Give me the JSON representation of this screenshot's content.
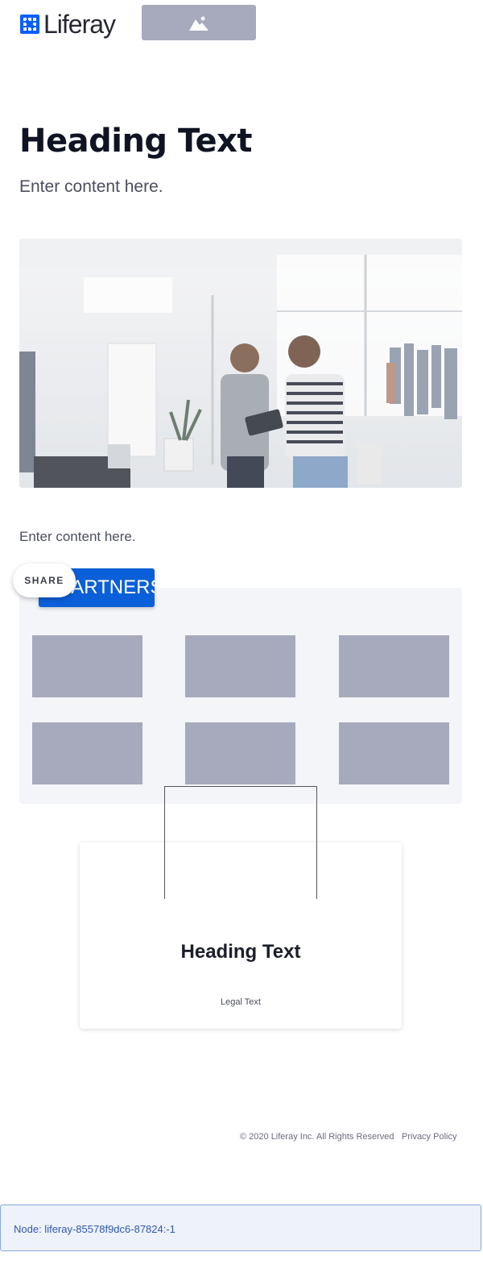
{
  "header": {
    "logo_text": "Liferay",
    "logo_icon": "liferay-grid-icon",
    "image_placeholder_icon": "image-icon"
  },
  "hero": {
    "title": "Heading Text",
    "subtitle": "Enter content here."
  },
  "content": {
    "text": "Enter content here."
  },
  "partners": {
    "button_label": "PARTNERS",
    "share_label": "SHARE",
    "tiles": [
      "",
      "",
      "",
      "",
      "",
      ""
    ]
  },
  "card": {
    "title": "Heading Text",
    "legal": "Legal Text"
  },
  "footer": {
    "copyright": "© 2020 Liferay Inc. All Rights Reserved",
    "privacy": "Privacy Policy"
  },
  "node_bar": {
    "text": "Node: liferay-85578f9dc6-87824:-1"
  },
  "colors": {
    "accent": "#0b5fd8",
    "placeholder": "#a7a9bc",
    "panel": "#f4f5f9",
    "node_bg": "#eef2fa"
  }
}
